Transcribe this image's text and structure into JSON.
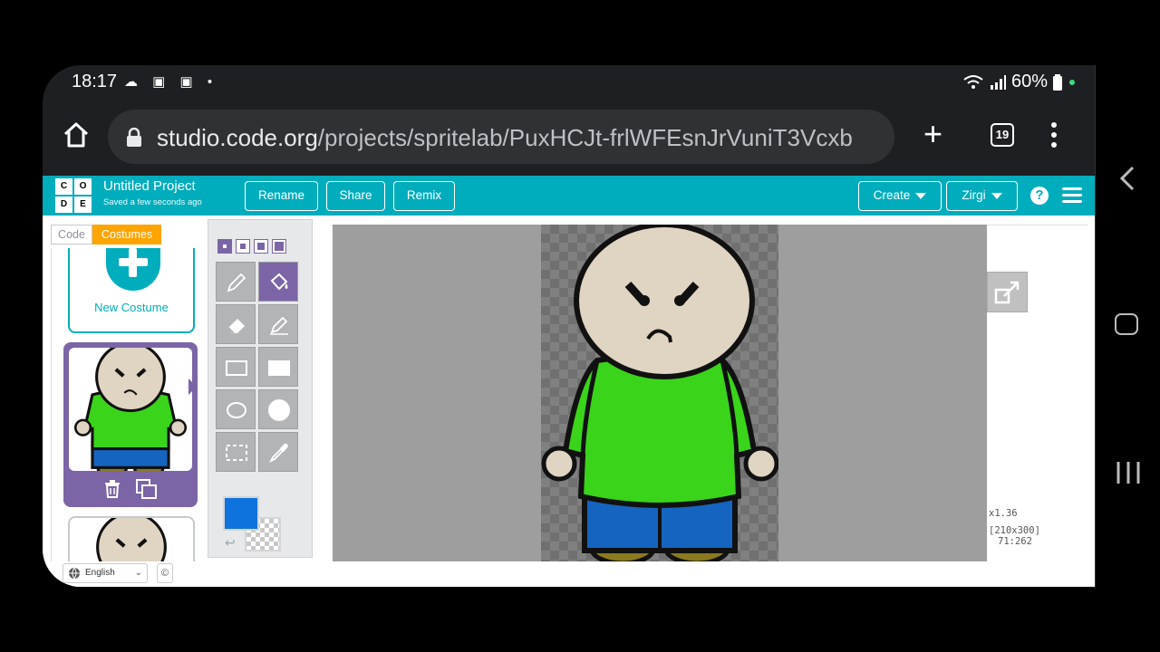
{
  "status_bar": {
    "time": "18:17",
    "battery": "60%"
  },
  "browser": {
    "url_host": "studio.code.org",
    "url_path": "/projects/spritelab/PuxHCJt-frlWFEsnJrVuniT3Vcxb",
    "tab_count": "19"
  },
  "app": {
    "logo_letters": [
      "C",
      "O",
      "D",
      "E"
    ],
    "project_title": "Untitled Project",
    "save_status": "Saved a few seconds ago",
    "rename_label": "Rename",
    "share_label": "Share",
    "remix_label": "Remix",
    "create_label": "Create",
    "user_label": "Zirgi",
    "help_label": "?",
    "accent_color": "#00adbc"
  },
  "tabs": {
    "code": "Code",
    "costumes": "Costumes"
  },
  "costumes": {
    "new_costume_label": "New Costume"
  },
  "canvas_info": {
    "zoom": "x1.36",
    "dimensions": "[210x300]",
    "cursor": "71:262"
  },
  "colors": {
    "fill": "#0f73dd",
    "selected_tool": "#7b65a6"
  },
  "footer": {
    "language": "English",
    "copyright": "©"
  }
}
